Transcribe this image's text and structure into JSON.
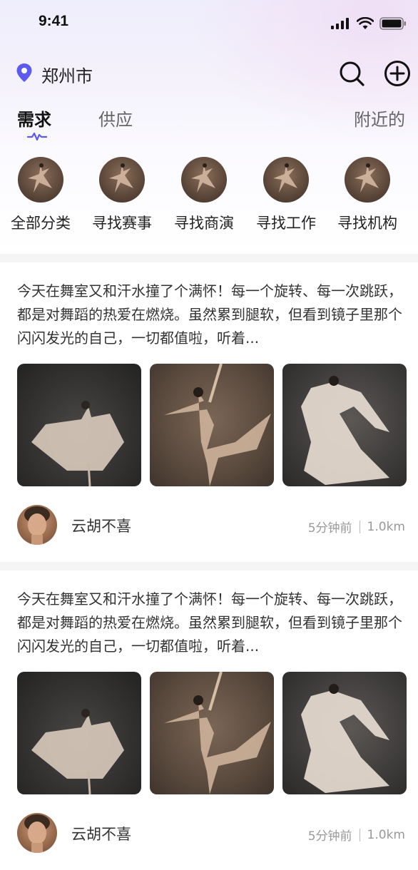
{
  "status_bar": {
    "time": "9:41"
  },
  "location": {
    "city": "郑州市"
  },
  "tabs": [
    {
      "label": "需求"
    },
    {
      "label": "供应"
    },
    {
      "label": "附近的"
    }
  ],
  "categories": [
    {
      "label": "全部分类"
    },
    {
      "label": "寻找赛事"
    },
    {
      "label": "寻找商演"
    },
    {
      "label": "寻找工作"
    },
    {
      "label": "寻找机构"
    }
  ],
  "posts": [
    {
      "text": "今天在舞室又和汗水撞了个满怀！每一个旋转、每一次跳跃，都是对舞蹈的热爱在燃烧。虽然累到腿软，但看到镜子里那个闪闪发光的自己，一切都值啦，听着...",
      "author": "云胡不喜",
      "time": "5分钟前",
      "distance": "1.0km"
    },
    {
      "text": "今天在舞室又和汗水撞了个满怀！每一个旋转、每一次跳跃，都是对舞蹈的热爱在燃烧。虽然累到腿软，但看到镜子里那个闪闪发光的自己，一切都值啦，听着...",
      "author": "云胡不喜",
      "time": "5分钟前",
      "distance": "1.0km"
    }
  ],
  "colors": {
    "accent": "#5b5bf0",
    "text_primary": "#222222",
    "text_secondary": "#999999"
  },
  "icons": {
    "location": "location-pin-icon",
    "search": "search-icon",
    "add": "add-circle-icon"
  }
}
